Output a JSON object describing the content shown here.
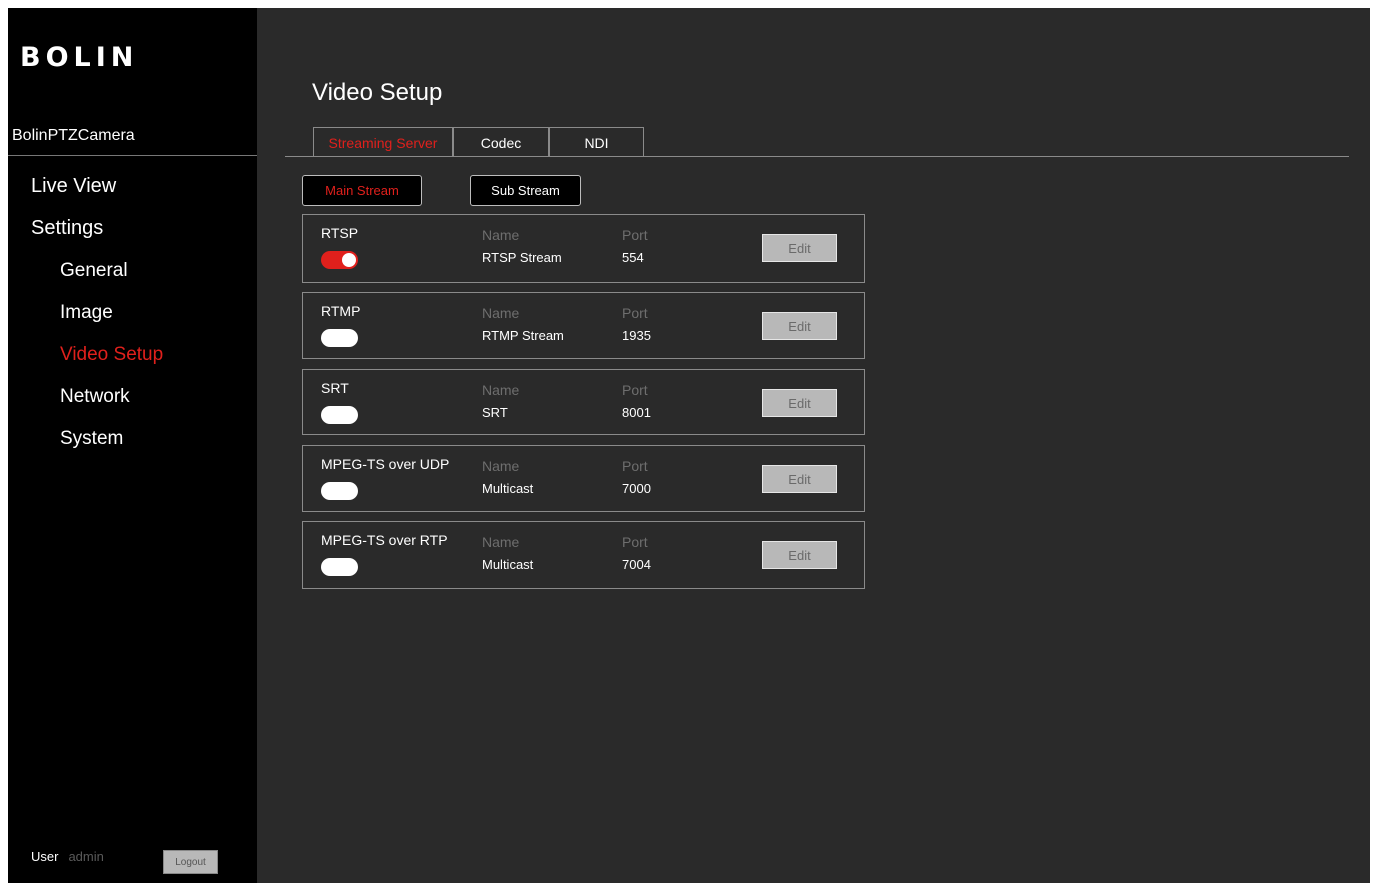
{
  "sidebar": {
    "logo": "BOLIN",
    "device_name": "BolinPTZCamera",
    "nav": {
      "live_view": "Live View",
      "settings": "Settings",
      "general": "General",
      "image": "Image",
      "video_setup": "Video Setup",
      "network": "Network",
      "system": "System"
    },
    "active_item": "Video Setup",
    "user_label": "User",
    "user_value": "admin",
    "logout_label": "Logout"
  },
  "main": {
    "title": "Video Setup",
    "tabs": [
      {
        "label": "Streaming Server",
        "active": true
      },
      {
        "label": "Codec",
        "active": false
      },
      {
        "label": "NDI",
        "active": false
      }
    ],
    "stream_buttons": [
      {
        "label": "Main Stream",
        "active": true
      },
      {
        "label": "Sub Stream",
        "active": false
      }
    ],
    "name_label": "Name",
    "port_label": "Port",
    "edit_label": "Edit",
    "protocols": [
      {
        "protocol": "RTSP",
        "enabled": true,
        "name": "RTSP Stream",
        "port": "554"
      },
      {
        "protocol": "RTMP",
        "enabled": false,
        "name": "RTMP Stream",
        "port": "1935"
      },
      {
        "protocol": "SRT",
        "enabled": false,
        "name": "SRT",
        "port": "8001"
      },
      {
        "protocol": "MPEG-TS over UDP",
        "enabled": false,
        "name": "Multicast",
        "port": "7000"
      },
      {
        "protocol": "MPEG-TS over RTP",
        "enabled": false,
        "name": "Multicast",
        "port": "7004"
      }
    ]
  },
  "colors": {
    "accent": "#e0201c",
    "sidebar_bg": "#000000",
    "main_bg": "#2a2a2a",
    "toggle_off": "#ffffff",
    "button_gray": "#b8b8b8"
  }
}
